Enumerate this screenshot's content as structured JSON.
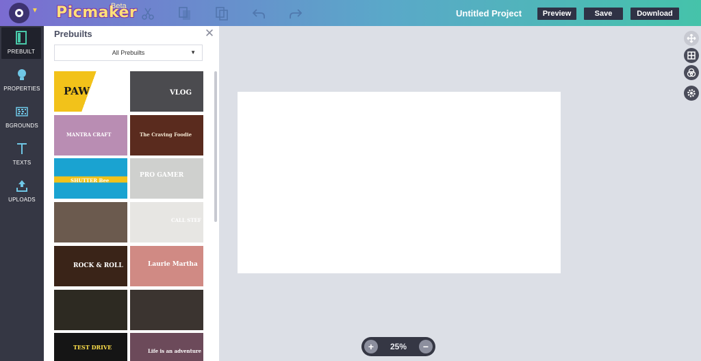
{
  "app": {
    "brand": "Picmaker",
    "badge": "Beta",
    "project_title": "Untitled Project"
  },
  "toolbar": {
    "preview_label": "Preview",
    "save_label": "Save",
    "download_label": "Download",
    "tools": [
      "cut-icon",
      "copy-icon",
      "duplicate-icon",
      "undo-icon",
      "redo-icon"
    ]
  },
  "nav": {
    "items": [
      {
        "label": "PREBUILT",
        "icon": "layout-icon",
        "active": true
      },
      {
        "label": "PROPERTIES",
        "icon": "bulb-icon",
        "active": false
      },
      {
        "label": "BGROUNDS",
        "icon": "pattern-icon",
        "active": false
      },
      {
        "label": "TEXTS",
        "icon": "text-icon",
        "active": false
      },
      {
        "label": "UPLOADS",
        "icon": "upload-icon",
        "active": false
      }
    ]
  },
  "panel": {
    "title": "Prebuilts",
    "filter_value": "All Prebuilts",
    "thumbnails": [
      {
        "text": "PAW",
        "bg": "#f2c21a"
      },
      {
        "text": "VLOG",
        "bg": "#4b4b4f"
      },
      {
        "text": "MANTRA CRAFT",
        "bg": "#b98db3"
      },
      {
        "text": "The Craving Foodie",
        "bg": "#5a2b1e"
      },
      {
        "text": "SHUTTER Bee",
        "bg": "#1aa3d1"
      },
      {
        "text": "PRO GAMER",
        "bg": "#cfd0ce"
      },
      {
        "text": "",
        "bg": "#6b5a4e"
      },
      {
        "text": "CALL STEF",
        "bg": "#e7e6e3"
      },
      {
        "text": "ROCK & ROLL",
        "bg": "#3a2418"
      },
      {
        "text": "Laurie Martha",
        "bg": "#d08a84"
      },
      {
        "text": "",
        "bg": "#2d2a22"
      },
      {
        "text": "",
        "bg": "#3b3430"
      },
      {
        "text": "TEST DRIVE",
        "bg": "#151515"
      },
      {
        "text": "Life is an adventure",
        "bg": "#6c4a5a"
      }
    ]
  },
  "canvas": {
    "zoom_label": "25%"
  },
  "side_tools": [
    "move-icon",
    "grid-icon",
    "color-icon",
    "settings-icon"
  ],
  "colors": {
    "topbar_start": "#7b6cd1",
    "topbar_end": "#45c3aa",
    "nav_bg": "#353744",
    "workspace_bg": "#dcdfe6"
  }
}
